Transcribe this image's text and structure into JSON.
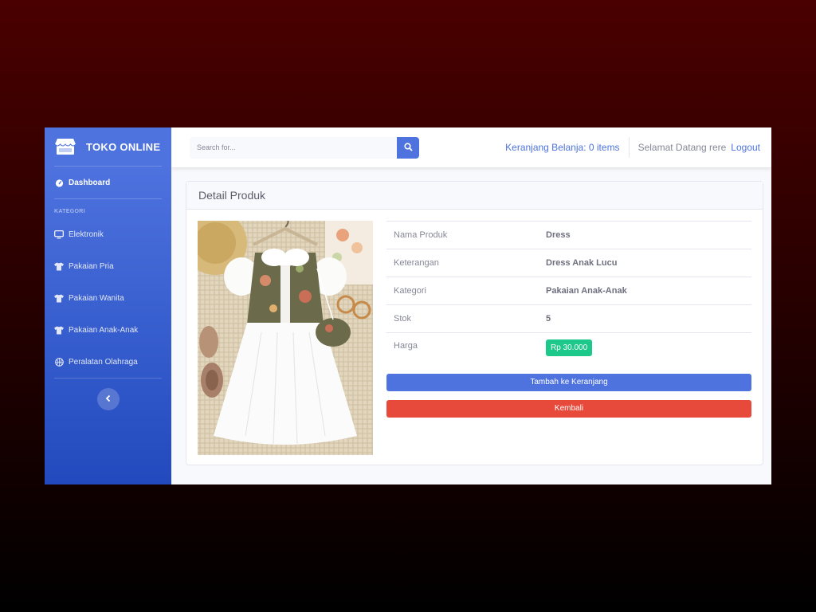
{
  "brand": {
    "name": "TOKO ONLINE",
    "icon": "store-icon"
  },
  "sidebar": {
    "dashboard": {
      "label": "Dashboard",
      "icon": "tachometer-icon"
    },
    "heading": "KATEGORI",
    "items": [
      {
        "label": "Elektronik",
        "icon": "desktop-icon"
      },
      {
        "label": "Pakaian Pria",
        "icon": "tshirt-icon"
      },
      {
        "label": "Pakaian Wanita",
        "icon": "tshirt-icon"
      },
      {
        "label": "Pakaian Anak-Anak",
        "icon": "tshirt-icon"
      },
      {
        "label": "Peralatan Olahraga",
        "icon": "basketball-icon"
      }
    ],
    "toggle_icon": "chevron-left-icon"
  },
  "topbar": {
    "search_placeholder": "Search for...",
    "search_icon": "search-icon",
    "cart": "Keranjang Belanja: 0 items",
    "greeting": "Selamat Datang rere",
    "logout": "Logout"
  },
  "card": {
    "title": "Detail Produk",
    "rows": [
      {
        "label": "Nama Produk",
        "value": "Dress"
      },
      {
        "label": "Keterangan",
        "value": "Dress Anak Lucu"
      },
      {
        "label": "Kategori",
        "value": "Pakaian Anak-Anak"
      },
      {
        "label": "Stok",
        "value": "5"
      },
      {
        "label": "Harga",
        "value": "Rp 30.000"
      }
    ],
    "add_to_cart": "Tambah ke Keranjang",
    "back": "Kembali"
  },
  "colors": {
    "primary": "#4e73df",
    "success": "#1cc88a",
    "danger": "#e74a3b"
  }
}
